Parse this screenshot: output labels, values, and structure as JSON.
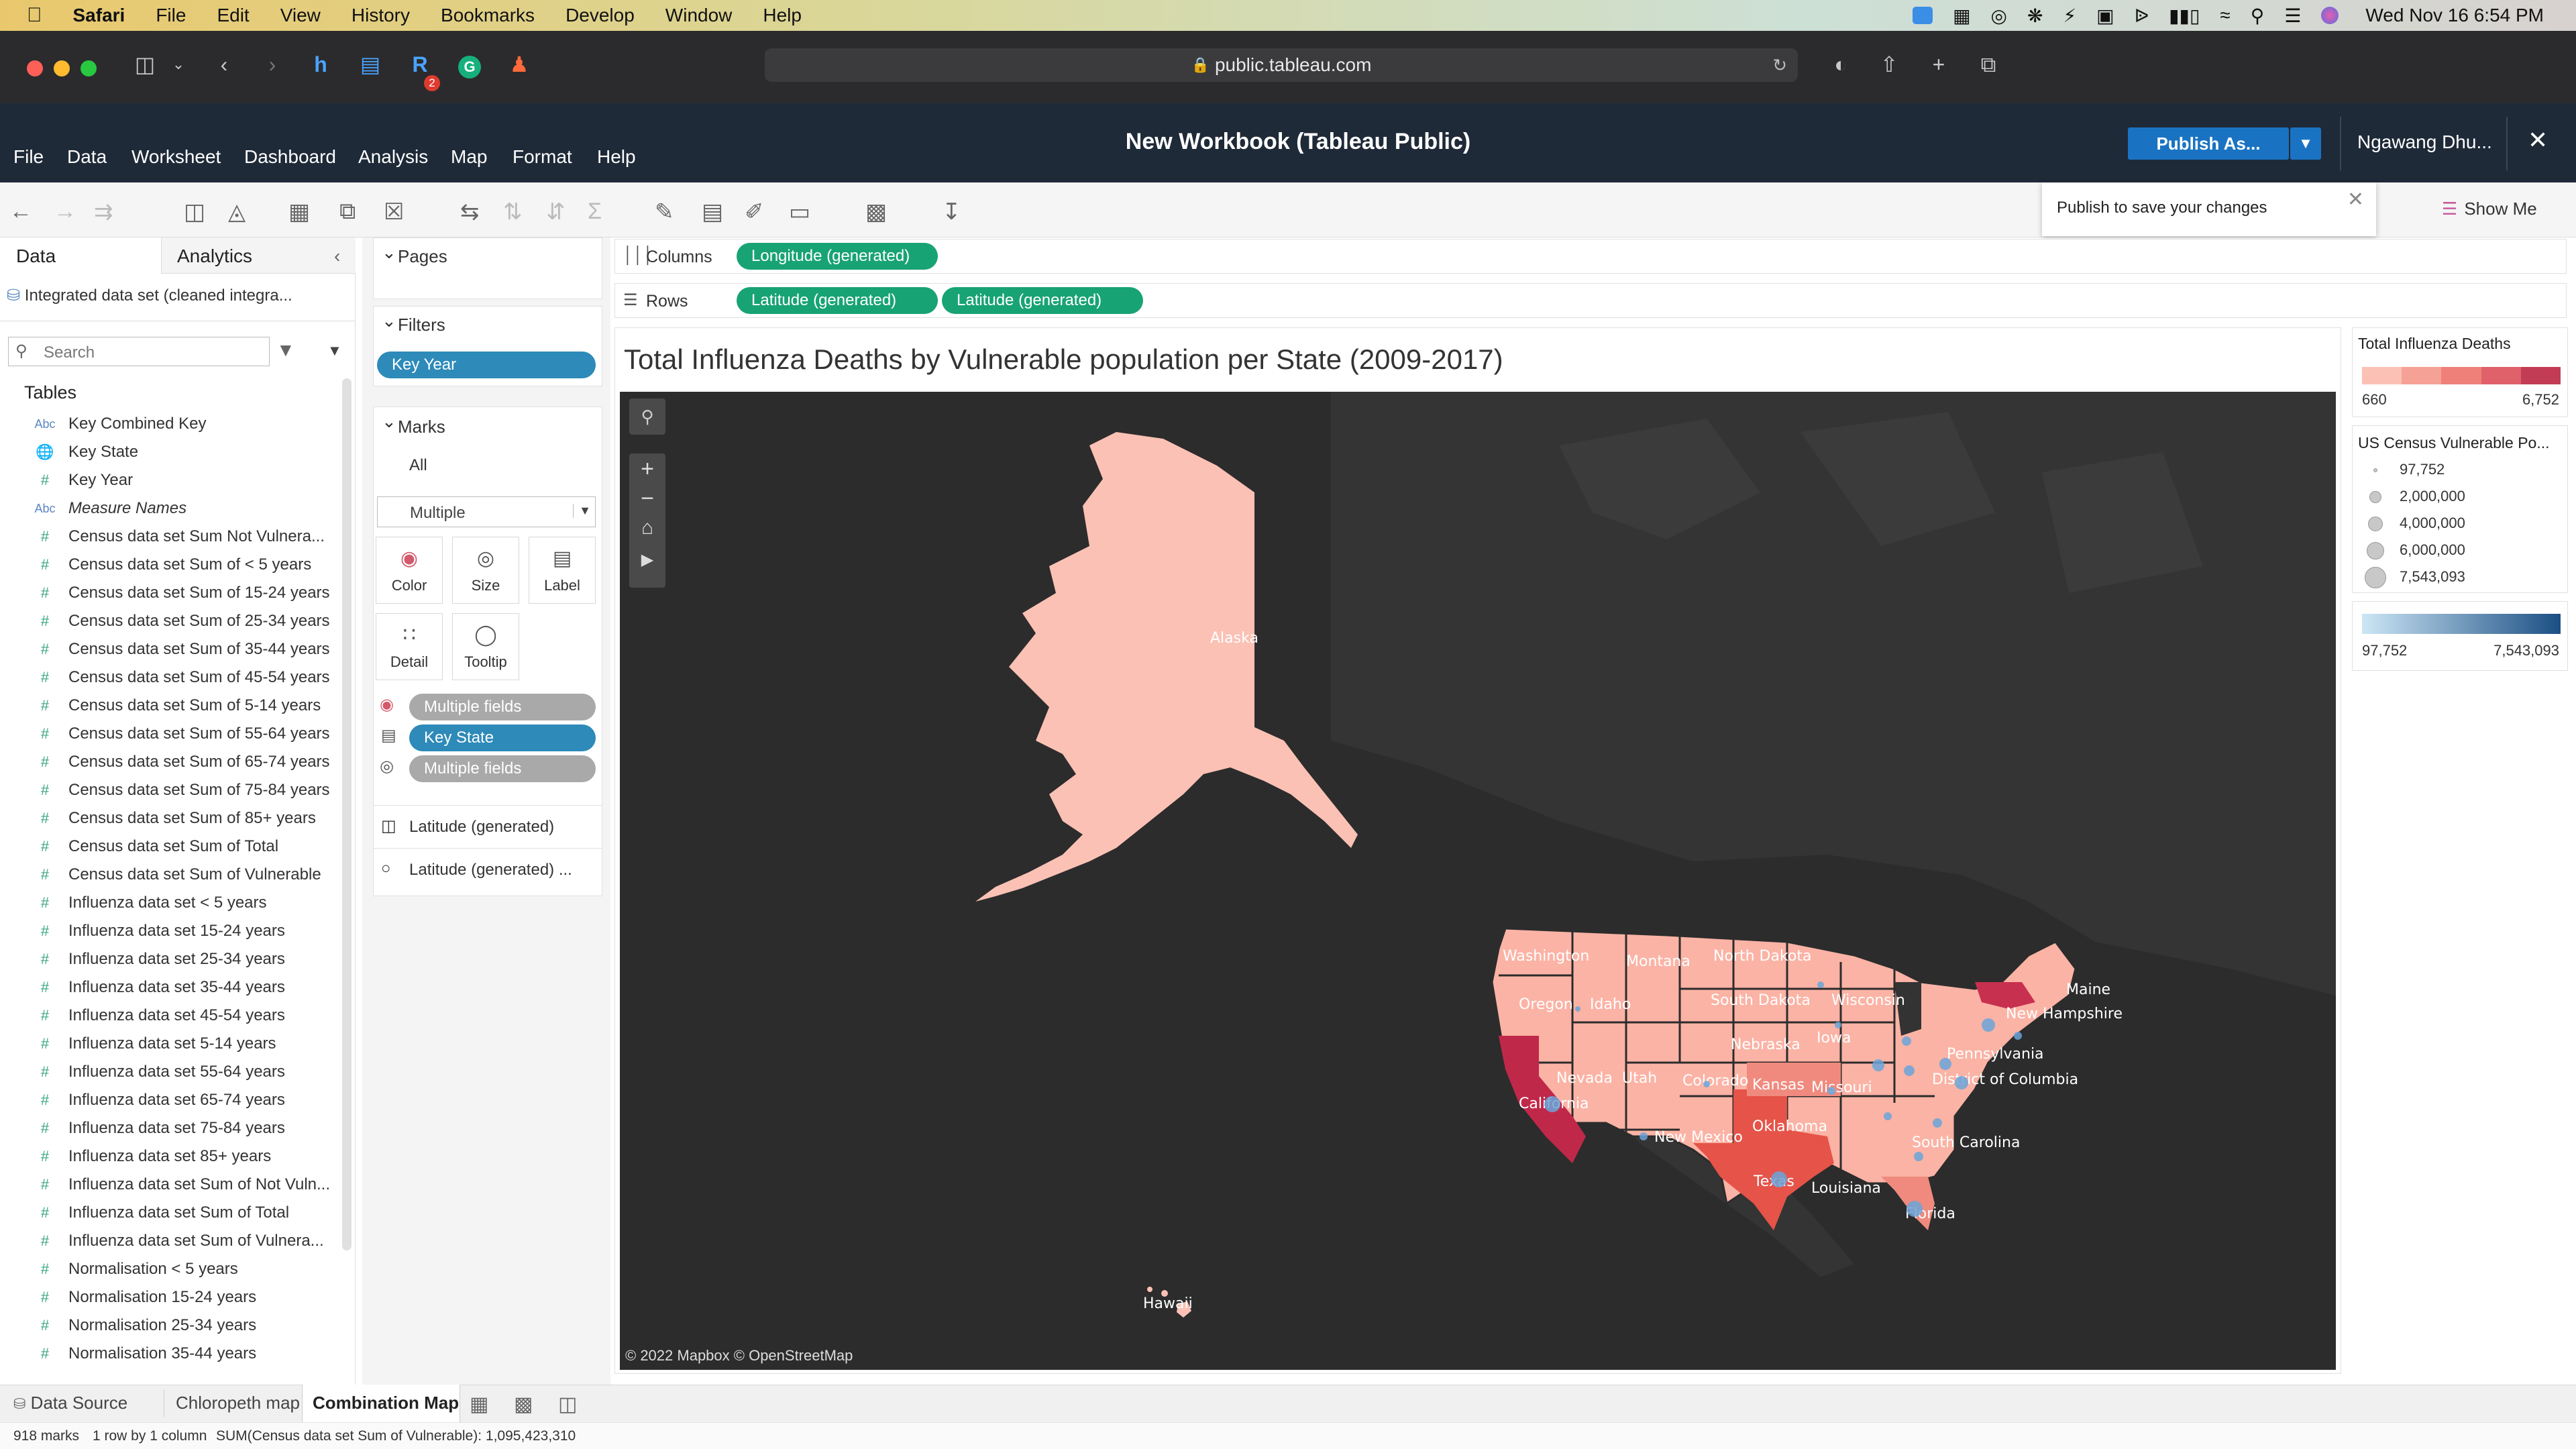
{
  "mac_menubar": {
    "app": "Safari",
    "items": [
      "File",
      "Edit",
      "View",
      "History",
      "Bookmarks",
      "Develop",
      "Window",
      "Help"
    ],
    "clock": "Wed Nov 16  6:54 PM"
  },
  "safari": {
    "url": "public.tableau.com",
    "badge_count": "2"
  },
  "tableau": {
    "title": "New Workbook (Tableau Public)",
    "menu": [
      "File",
      "Data",
      "Worksheet",
      "Dashboard",
      "Analysis",
      "Map",
      "Format",
      "Help"
    ],
    "publish_label": "Publish As...",
    "user": "Ngawang Dhu...",
    "popover_text": "Publish to save your changes",
    "show_me": "Show Me"
  },
  "data_pane": {
    "tab_data": "Data",
    "tab_analytics": "Analytics",
    "datasource": "Integrated data set (cleaned integra...",
    "search_placeholder": "Search",
    "tables_heading": "Tables",
    "fields": [
      {
        "type": "Abc",
        "name": "Key Combined Key"
      },
      {
        "type": "globe",
        "name": "Key State"
      },
      {
        "type": "#",
        "name": "Key Year"
      },
      {
        "type": "Abc",
        "name": "Measure Names"
      },
      {
        "type": "#",
        "name": "Census data set Sum Not Vulnera..."
      },
      {
        "type": "#",
        "name": "Census data set Sum of < 5 years"
      },
      {
        "type": "#",
        "name": "Census data set Sum of 15-24 years"
      },
      {
        "type": "#",
        "name": "Census data set Sum of 25-34 years"
      },
      {
        "type": "#",
        "name": "Census data set Sum of 35-44 years"
      },
      {
        "type": "#",
        "name": "Census data set Sum of 45-54 years"
      },
      {
        "type": "#",
        "name": "Census data set Sum of 5-14 years"
      },
      {
        "type": "#",
        "name": "Census data set Sum of 55-64 years"
      },
      {
        "type": "#",
        "name": "Census data set Sum of 65-74 years"
      },
      {
        "type": "#",
        "name": "Census data set Sum of 75-84 years"
      },
      {
        "type": "#",
        "name": "Census data set Sum of 85+ years"
      },
      {
        "type": "#",
        "name": "Census data set Sum of Total"
      },
      {
        "type": "#",
        "name": "Census data set Sum of Vulnerable"
      },
      {
        "type": "#",
        "name": "Influenza data set < 5 years"
      },
      {
        "type": "#",
        "name": "Influenza data set 15-24 years"
      },
      {
        "type": "#",
        "name": "Influenza data set 25-34 years"
      },
      {
        "type": "#",
        "name": "Influenza data set 35-44 years"
      },
      {
        "type": "#",
        "name": "Influenza data set 45-54 years"
      },
      {
        "type": "#",
        "name": "Influenza data set 5-14 years"
      },
      {
        "type": "#",
        "name": "Influenza data set 55-64 years"
      },
      {
        "type": "#",
        "name": "Influenza data set 65-74 years"
      },
      {
        "type": "#",
        "name": "Influenza data set 75-84 years"
      },
      {
        "type": "#",
        "name": "Influenza data set 85+ years"
      },
      {
        "type": "#",
        "name": "Influenza data set Sum of Not Vuln..."
      },
      {
        "type": "#",
        "name": "Influenza data set Sum of Total"
      },
      {
        "type": "#",
        "name": "Influenza data set Sum of Vulnera..."
      },
      {
        "type": "#",
        "name": "Normalisation < 5 years"
      },
      {
        "type": "#",
        "name": "Normalisation 15-24 years"
      },
      {
        "type": "#",
        "name": "Normalisation 25-34 years"
      },
      {
        "type": "#",
        "name": "Normalisation 35-44 years"
      }
    ]
  },
  "shelves": {
    "pages": "Pages",
    "filters": "Filters",
    "filter_pill": "Key Year",
    "marks": "Marks",
    "marks_all": "All",
    "mark_type": "Multiple",
    "mark_buttons": [
      "Color",
      "Size",
      "Label",
      "Detail",
      "Tooltip"
    ],
    "mark_pills": [
      "Multiple fields",
      "Key State",
      "Multiple fields"
    ],
    "mark_layers": [
      "Latitude (generated)",
      "Latitude (generated) ..."
    ],
    "columns_label": "Columns",
    "columns_pill": "Longitude (generated)",
    "rows_label": "Rows",
    "rows_pills": [
      "Latitude (generated)",
      "Latitude (generated)"
    ]
  },
  "view": {
    "title": "Total Influenza Deaths by Vulnerable population per State (2009-2017)",
    "attribution": "© 2022 Mapbox  © OpenStreetMap",
    "state_labels": {
      "alaska": "Alaska",
      "hawaii": "Hawaii",
      "washington": "Washington",
      "montana": "Montana",
      "north_dakota": "North Dakota",
      "oregon": "Oregon",
      "idaho": "Idaho",
      "south_dakota": "South Dakota",
      "wisconsin": "Wisconsin",
      "maine": "Maine",
      "new_hampshire": "New Hampshire",
      "nebraska": "Nebraska",
      "iowa": "Iowa",
      "pennsylvania": "Pennsylvania",
      "nevada": "Nevada",
      "utah": "Utah",
      "colorado": "Colorado",
      "kansas": "Kansas",
      "missouri": "Missouri",
      "district_of_columbia": "District of Columbia",
      "california": "California",
      "oklahoma": "Oklahoma",
      "new_mexico": "New Mexico",
      "south_carolina": "South Carolina",
      "texas": "Texas",
      "louisiana": "Louisiana",
      "florida": "Florida"
    }
  },
  "legends": {
    "deaths_title": "Total Influenza Deaths",
    "deaths_min": "660",
    "deaths_max": "6,752",
    "deaths_colors": [
      "#fbc1b5",
      "#f6a196",
      "#ee8079",
      "#e0616a",
      "#c23c55"
    ],
    "pop_title": "US Census Vulnerable Po...",
    "pop_sizes": [
      "97,752",
      "2,000,000",
      "4,000,000",
      "6,000,000",
      "7,543,093"
    ],
    "gradient_min": "97,752",
    "gradient_max": "7,543,093"
  },
  "bottom": {
    "tabs": [
      "Data Source",
      "Chloropeth map",
      "Combination Map"
    ],
    "active_tab": "Combination Map",
    "status_marks": "918 marks",
    "status_dims": "1 row by 1 column",
    "status_sum": "SUM(Census data set Sum of Vulnerable): 1,095,423,310"
  }
}
